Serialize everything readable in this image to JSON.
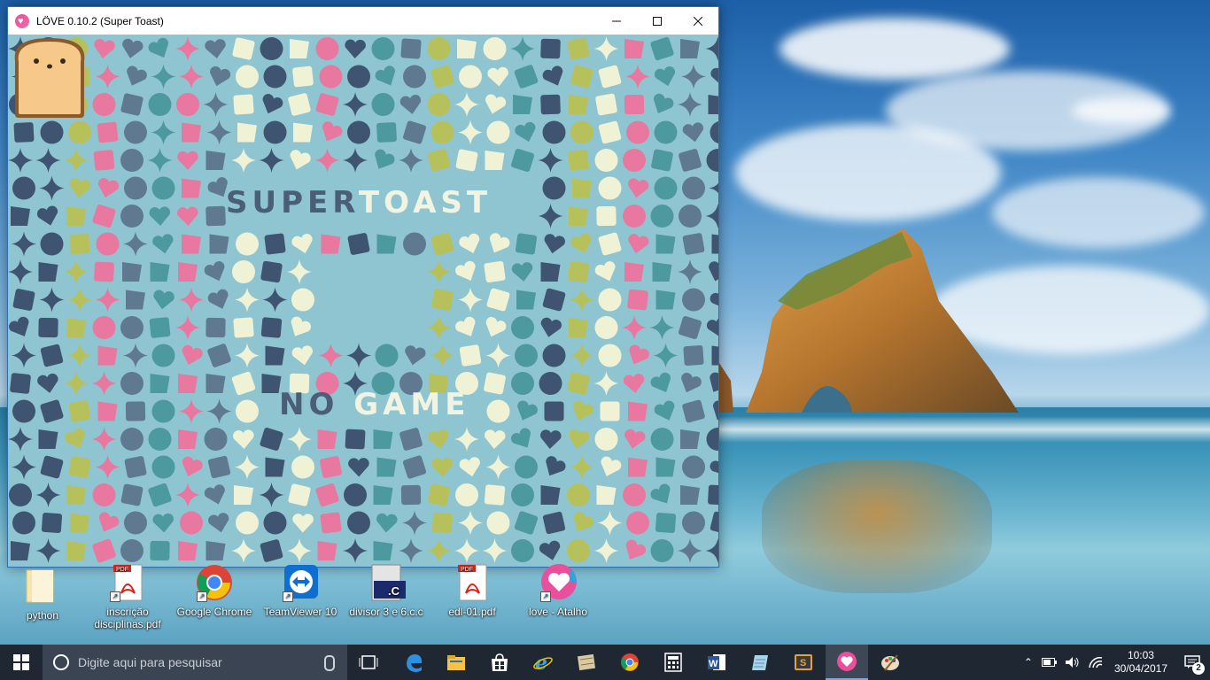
{
  "window": {
    "title": "LÖVE 0.10.2 (Super Toast)",
    "minimize_icon": "minimize-icon",
    "maximize_icon": "maximize-icon",
    "close_icon": "close-icon",
    "game": {
      "title_word1": "SUPER",
      "title_word2": "TOAST",
      "subtitle_word1": "NO",
      "subtitle_word2": "GAME",
      "background_color": "#8fc5d1",
      "shape_colors": [
        "#3e5470",
        "#4d99a0",
        "#b6c15b",
        "#e8789f",
        "#f0f2d6",
        "#5f7990"
      ]
    }
  },
  "desktop_icons": [
    {
      "label": "python",
      "icon": "folder-icon"
    },
    {
      "label": "inscrição disciplinas.pdf",
      "icon": "pdf-icon"
    },
    {
      "label": "Google Chrome",
      "icon": "chrome-icon"
    },
    {
      "label": "TeamViewer 10",
      "icon": "teamviewer-icon"
    },
    {
      "label": "divisor 3 e 6.c.c",
      "icon": "c-file-icon"
    },
    {
      "label": "edl-01.pdf",
      "icon": "pdf-icon"
    },
    {
      "label": "love - Atalho",
      "icon": "love-icon"
    }
  ],
  "taskbar": {
    "search_placeholder": "Digite aqui para pesquisar",
    "apps": [
      "task-view-icon",
      "edge-icon",
      "file-explorer-icon",
      "store-icon",
      "internet-explorer-icon",
      "maps-icon",
      "chrome-icon",
      "calculator-icon",
      "word-icon",
      "notepad-icon",
      "sublime-icon",
      "love-icon",
      "paint-icon"
    ],
    "active_app": "love-icon",
    "time": "10:03",
    "date": "30/04/2017",
    "notification_count": "2"
  }
}
